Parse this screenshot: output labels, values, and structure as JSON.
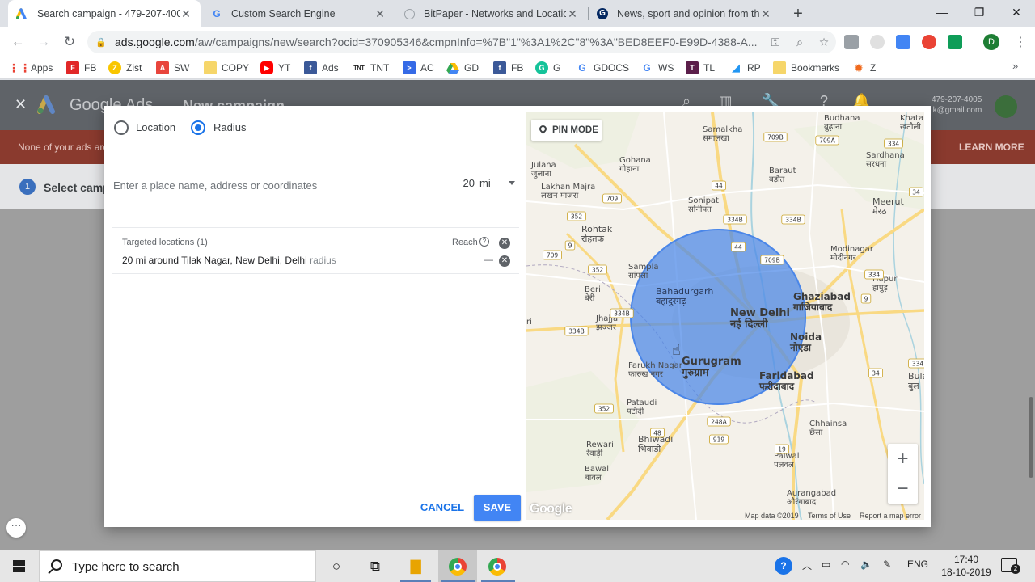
{
  "browser": {
    "tabs": [
      {
        "title": "Search campaign - 479-207-4005",
        "icon": "google-ads-icon"
      },
      {
        "title": "Custom Search Engine",
        "icon": "google-icon"
      },
      {
        "title": "BitPaper - Networks and Location",
        "icon": "bitpaper-icon"
      },
      {
        "title": "News, sport and opinion from th",
        "icon": "guardian-icon"
      }
    ],
    "url_domain": "ads.google.com",
    "url_path": "/aw/campaigns/new/search?ocid=370905346&cmpnInfo=%7B\"1\"%3A1%2C\"8\"%3A\"BED8EEF0-E99D-4388-A...",
    "profile_letter": "D",
    "bookmarks": [
      "Apps",
      "FB",
      "Zist",
      "SW",
      "COPY",
      "YT",
      "Ads",
      "TNT",
      "AC",
      "GD",
      "FB",
      "G",
      "GDOCS",
      "WS",
      "TL",
      "RP",
      "Bookmarks",
      "Z"
    ]
  },
  "ads": {
    "product": "Google Ads",
    "page_title": "New campaign",
    "account_id": "479-207-4005",
    "account_email": "k@gmail.com",
    "banner_text": "None of your ads are",
    "banner_action": "LEARN MORE",
    "step_number": "1",
    "step_label": "Select campa"
  },
  "modal": {
    "radio_location": "Location",
    "radio_radius": "Radius",
    "selected_mode": "Radius",
    "place_placeholder": "Enter a place name, address or coordinates",
    "radius_value": "20",
    "radius_unit": "mi",
    "targeted_header": "Targeted locations (1)",
    "reach_label": "Reach",
    "help_glyph": "?",
    "targeted_item_main": "20 mi around Tilak Nagar, New Delhi, Delhi",
    "targeted_item_suffix": "radius",
    "targeted_item_reach": "—",
    "cancel_label": "CANCEL",
    "save_label": "SAVE"
  },
  "map": {
    "pin_mode_label": "PIN MODE",
    "zoom_in": "+",
    "zoom_out": "−",
    "watermark": "Google",
    "footer": [
      "Map data ©2019",
      "Terms of Use",
      "Report a map error"
    ],
    "circle_color": "#4a86e8",
    "places": [
      {
        "en": "Khatauli",
        "hi": "खतौली"
      },
      {
        "en": "Budhana",
        "hi": "बुढ़ाना"
      },
      {
        "en": "Samalkha",
        "hi": "समालखा"
      },
      {
        "en": "Gohana",
        "hi": "गोहाना"
      },
      {
        "en": "Julana",
        "hi": "जुलाना"
      },
      {
        "en": "Lakhan Majra",
        "hi": "लखन माजरा"
      },
      {
        "en": "Baraut",
        "hi": "बड़ौत"
      },
      {
        "en": "Sardhana",
        "hi": "सरधना"
      },
      {
        "en": "Sonipat",
        "hi": "सोनीपत"
      },
      {
        "en": "Meerut",
        "hi": "मेरठ"
      },
      {
        "en": "Rohtak",
        "hi": "रोहतक"
      },
      {
        "en": "Modinagar",
        "hi": "मोदीनगर"
      },
      {
        "en": "Sampla",
        "hi": "सांपला"
      },
      {
        "en": "Bahadurgarh",
        "hi": "बहादुरगढ़"
      },
      {
        "en": "Hapur",
        "hi": "हापुड़"
      },
      {
        "en": "Beri",
        "hi": "बेरी"
      },
      {
        "en": "Ghaziabad",
        "hi": "गाजियाबाद"
      },
      {
        "en": "New Delhi",
        "hi": "नई दिल्ली"
      },
      {
        "en": "Jhajjar",
        "hi": "झज्जर"
      },
      {
        "en": "Noida",
        "hi": "नोएडा"
      },
      {
        "en": "Farukh Nagar",
        "hi": "फारुख नगर"
      },
      {
        "en": "Gurugram",
        "hi": "गुरुग्राम"
      },
      {
        "en": "Faridabad",
        "hi": "फरीदाबाद"
      },
      {
        "en": "Bulan",
        "hi": "बुलं"
      },
      {
        "en": "Pataudi",
        "hi": "पटौदी"
      },
      {
        "en": "Chhainsa",
        "hi": "छैंसा"
      },
      {
        "en": "Bhiwadi",
        "hi": "भिवाड़ी"
      },
      {
        "en": "Rewari",
        "hi": "रेवाड़ी"
      },
      {
        "en": "Palwal",
        "hi": "पलवल"
      },
      {
        "en": "Bawal",
        "hi": "बावल"
      },
      {
        "en": "Aurangabad",
        "hi": "औरंगाबाद"
      }
    ],
    "road_shields": [
      "709B",
      "709A",
      "334",
      "44",
      "709",
      "352",
      "334B",
      "334B",
      "34",
      "9",
      "709",
      "352",
      "44",
      "709B",
      "9",
      "334",
      "334B",
      "334B",
      "334",
      "34",
      "352",
      "48",
      "248A",
      "919",
      "19"
    ],
    "edge_fragment": "ri"
  },
  "taskbar": {
    "search_placeholder": "Type here to search",
    "language": "ENG",
    "time": "17:40",
    "date": "18-10-2019",
    "notification_count": "2"
  }
}
